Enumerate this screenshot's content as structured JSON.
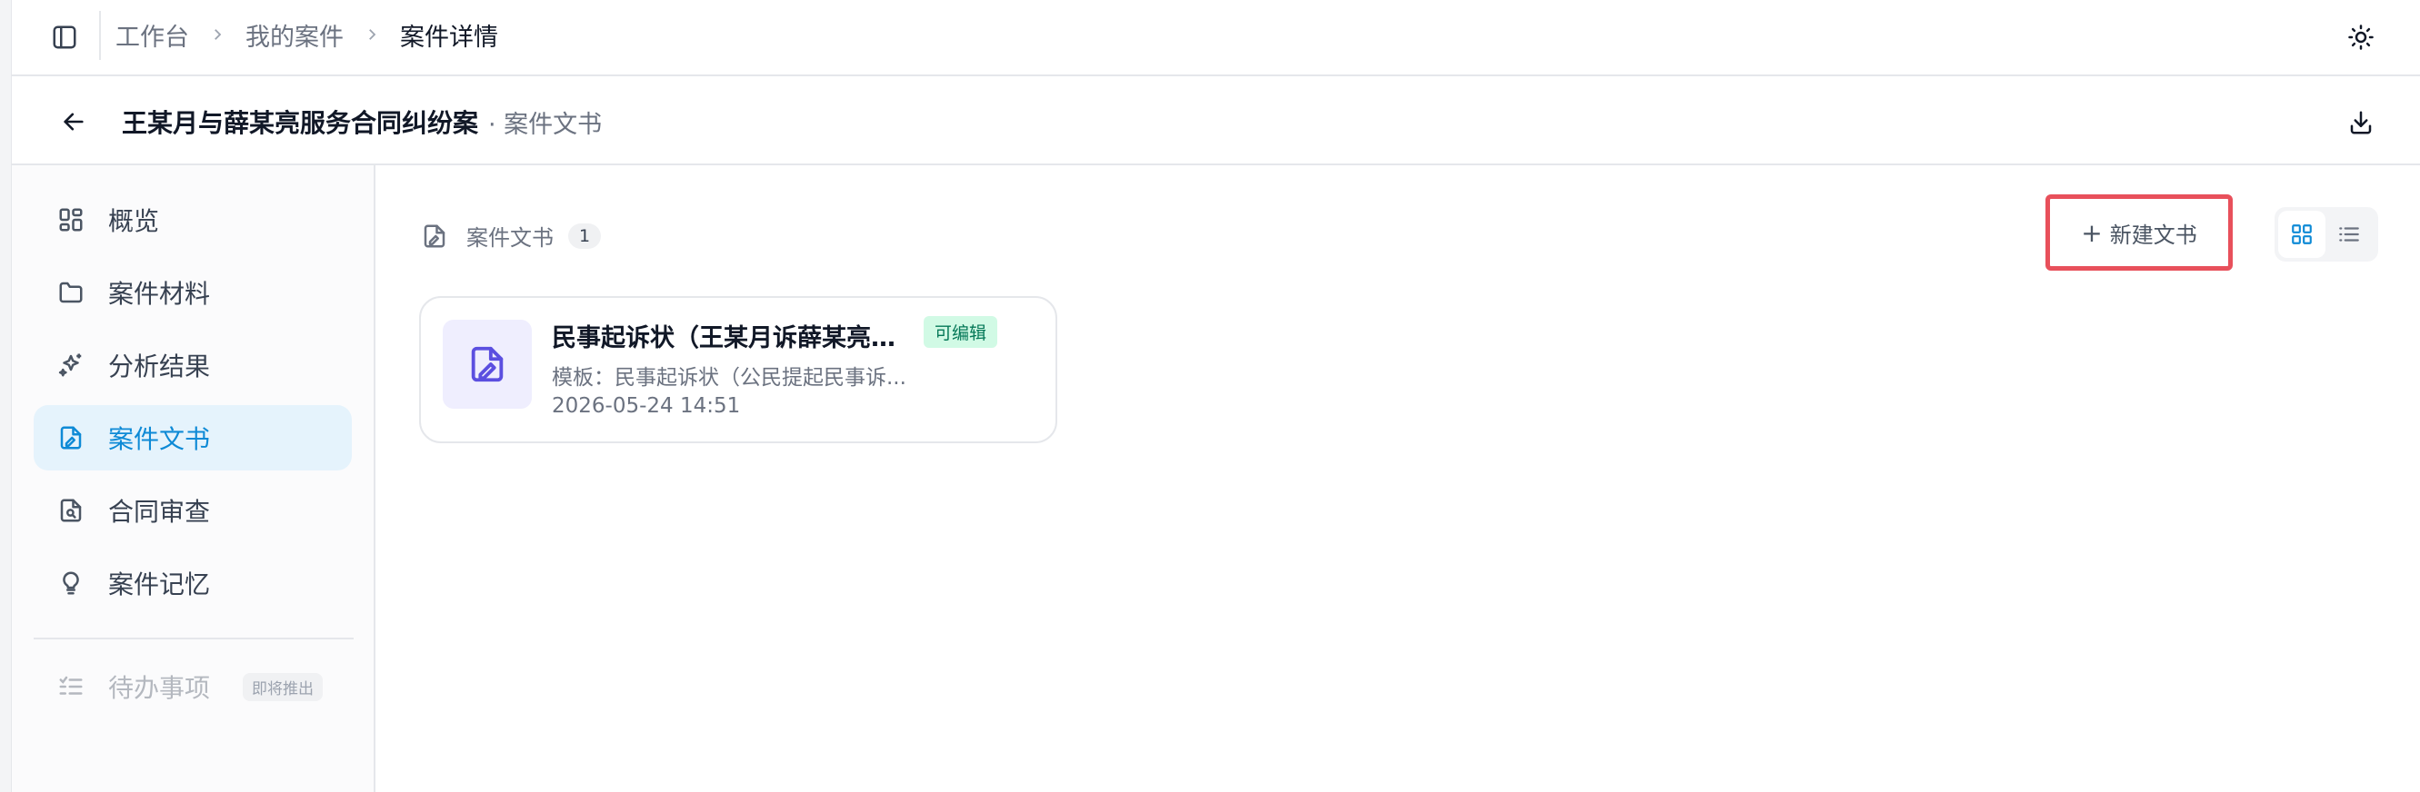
{
  "breadcrumb": [
    "工作台",
    "我的案件",
    "案件详情"
  ],
  "case": {
    "title": "王某月与薛某亮服务合同纠纷案",
    "section": "· 案件文书"
  },
  "sidebar": {
    "items": [
      {
        "label": "概览",
        "icon": "dashboard-icon"
      },
      {
        "label": "案件材料",
        "icon": "folder-icon"
      },
      {
        "label": "分析结果",
        "icon": "sparkles-icon"
      },
      {
        "label": "案件文书",
        "icon": "file-signature-icon",
        "active": true
      },
      {
        "label": "合同审查",
        "icon": "file-search-icon"
      },
      {
        "label": "案件记忆",
        "icon": "lightbulb-icon"
      }
    ],
    "todo": {
      "label": "待办事项",
      "badge": "即将推出"
    }
  },
  "main": {
    "section_title": "案件文书",
    "count": "1",
    "new_doc_label": "新建文书",
    "view_mode": "grid"
  },
  "documents": [
    {
      "title": "民事起诉状（王某月诉薛某亮公...",
      "tag": "可编辑",
      "template": "模板：民事起诉状（公民提起民事诉...",
      "time": "2026-05-24 14:51"
    }
  ],
  "colors": {
    "accent": "#0e8ad6",
    "active_bg": "#e5f3fc",
    "highlight_border": "#e8505b",
    "tag_bg": "#d1fae5",
    "tag_text": "#047857",
    "doc_icon": "#5b4fe0"
  }
}
